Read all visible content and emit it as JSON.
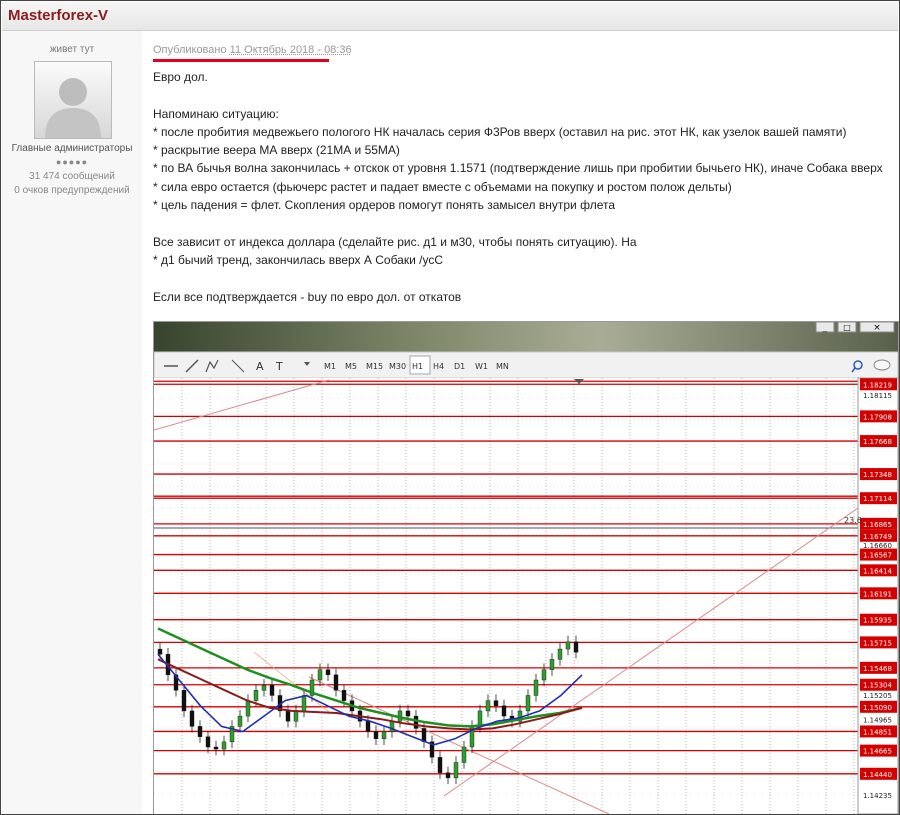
{
  "header": {
    "author": "Masterforex-V"
  },
  "sidebar": {
    "status": "живет тут",
    "group": "Главные администраторы",
    "pips": "●●●●●",
    "posts": "31 474 сообщений",
    "warnings": "0 очков предупреждений"
  },
  "post": {
    "published_label": "Опубликовано",
    "published_date": "11 Октябрь 2018 - 08:36",
    "lines": [
      "Евро дол.",
      "",
      "Напоминаю ситуацию:",
      "* после пробития медвежьего пологого НК началась серия Ф3Ров вверх (оставил на рис. этот НК, как узелок вашей памяти)",
      "* раскрытие веера МА вверх (21МА и 55МА)",
      "* по ВА бычья волна закончилась + отскок от уровня 1.1571 (подтверждение лишь при пробитии бычьего НК), иначе Собака вверх",
      "* сила евро остается (фьючерс растет и падает вместе с объемами на покупку и ростом полож дельты)",
      "* цель падения = флет. Скопления ордеров помогут понять замысел внутри флета",
      "",
      "Все зависит от индекса доллара (сделайте рис. д1 и м30, чтобы понять ситуацию). На",
      "* д1 бычий тренд, закончилась вверх А Собаки /усС",
      "",
      "Если все подтверждается - buy по евро дол. от откатов"
    ]
  },
  "chart_window": {
    "win_buttons": [
      "_",
      "□",
      "×"
    ],
    "timeframes": [
      "M1",
      "M5",
      "M15",
      "M30",
      "H1",
      "H4",
      "D1",
      "W1",
      "MN"
    ],
    "active_timeframe": "H1",
    "tool_labels": [
      "A",
      "T"
    ],
    "accent_red": "#d40000",
    "price_note": "23.6"
  },
  "chart_data": {
    "type": "line",
    "ylim": [
      1.1405,
      1.1828
    ],
    "labeled_levels": [
      1.18219,
      1.17908,
      1.17668,
      1.17348,
      1.17114,
      1.16865,
      1.16749,
      1.16567,
      1.16414,
      1.16191,
      1.15935,
      1.15715,
      1.15468,
      1.15304,
      1.1509,
      1.14851,
      1.14665,
      1.1444
    ],
    "price_ticks": [
      1.18115,
      1.1666,
      1.15205,
      1.14965,
      1.14235
    ],
    "candles_close": [
      1.156,
      1.154,
      1.1525,
      1.1505,
      1.149,
      1.148,
      1.147,
      1.1468,
      1.1475,
      1.149,
      1.15,
      1.1515,
      1.1525,
      1.153,
      1.152,
      1.1505,
      1.1495,
      1.1505,
      1.152,
      1.1535,
      1.1545,
      1.154,
      1.1525,
      1.1515,
      1.1505,
      1.1495,
      1.1485,
      1.1478,
      1.1485,
      1.1495,
      1.1505,
      1.15,
      1.1488,
      1.1475,
      1.146,
      1.1445,
      1.144,
      1.1455,
      1.147,
      1.149,
      1.1505,
      1.1515,
      1.151,
      1.15,
      1.1495,
      1.1505,
      1.152,
      1.1535,
      1.1545,
      1.1555,
      1.1565,
      1.1572,
      1.1562
    ],
    "ma_green": [
      1.1585,
      1.1575,
      1.1565,
      1.1555,
      1.1545,
      1.1537,
      1.153,
      1.1522,
      1.1515,
      1.1508,
      1.1503,
      1.1498,
      1.1494,
      1.1491,
      1.149,
      1.1492,
      1.1496,
      1.15,
      1.1503,
      1.1508
    ],
    "ma_darkred": [
      1.1555,
      1.1545,
      1.1535,
      1.1525,
      1.1515,
      1.1508,
      1.1505,
      1.1504,
      1.1503,
      1.15,
      1.1497,
      1.1493,
      1.149,
      1.1488,
      1.1487,
      1.1488,
      1.1492,
      1.1497,
      1.1502,
      1.1508
    ],
    "ma_blue": [
      1.156,
      1.1535,
      1.151,
      1.149,
      1.1485,
      1.15,
      1.1515,
      1.152,
      1.151,
      1.15,
      1.1495,
      1.1488,
      1.148,
      1.1472,
      1.1478,
      1.1488,
      1.1495,
      1.1498,
      1.1505,
      1.152,
      1.154
    ]
  }
}
